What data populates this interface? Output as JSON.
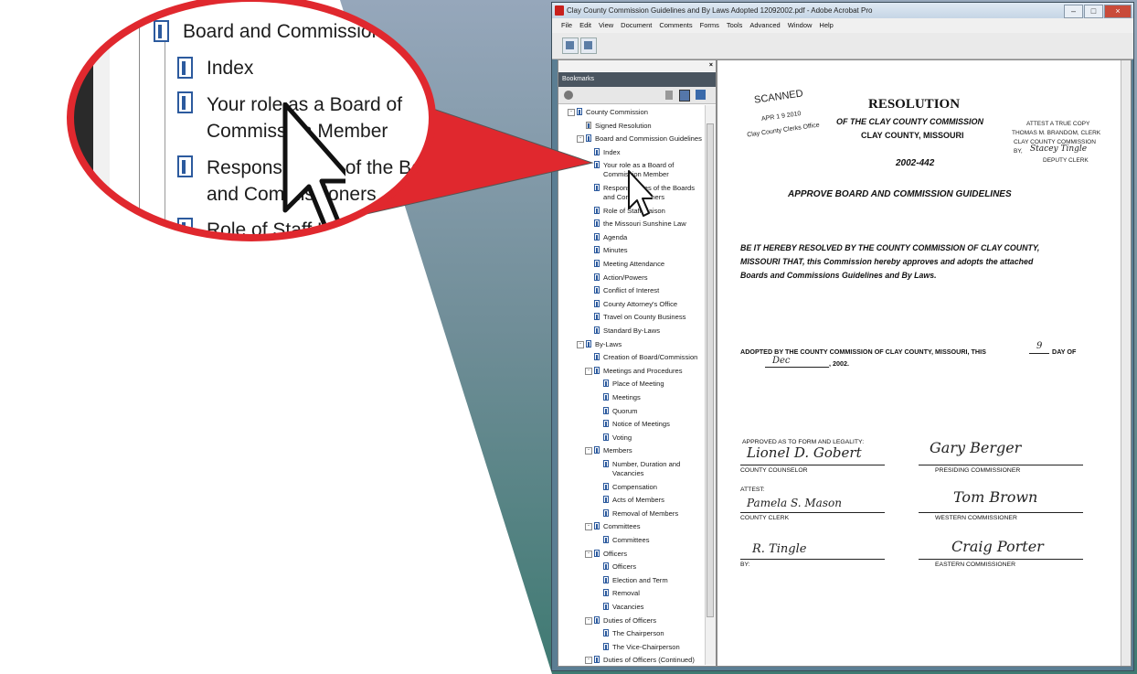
{
  "colors": {
    "accent_red": "#e0282e",
    "wedge_blue": "#8ea3b8",
    "wedge_teal": "#4e7d78"
  },
  "window": {
    "title": "Clay County Commission Guidelines and By Laws Adopted 12092002.pdf - Adobe Acrobat Pro",
    "controls": [
      "–",
      "□",
      "×"
    ]
  },
  "menu": [
    "File",
    "Edit",
    "View",
    "Document",
    "Comments",
    "Forms",
    "Tools",
    "Advanced",
    "Window",
    "Help"
  ],
  "panel": {
    "title": "Bookmarks",
    "close": "×"
  },
  "bookmarks": [
    {
      "label": "County Commission",
      "level": 0,
      "toggle": "-"
    },
    {
      "label": "Signed Resolution",
      "level": 1,
      "gray": true
    },
    {
      "label": "Board and Commission Guidelines",
      "level": 1,
      "toggle": "-"
    },
    {
      "label": "Index",
      "level": 2
    },
    {
      "label": "Your role as a Board of",
      "label2": "Commission Member",
      "level": 2
    },
    {
      "label": "Responsibilities of the Boards",
      "label2": "and Commissioners",
      "level": 2
    },
    {
      "label": "Role of Staff Liaison",
      "level": 2
    },
    {
      "label": "the Missouri Sunshine Law",
      "level": 2
    },
    {
      "label": "Agenda",
      "level": 2
    },
    {
      "label": "Minutes",
      "level": 2
    },
    {
      "label": "Meeting Attendance",
      "level": 2
    },
    {
      "label": "Action/Powers",
      "level": 2
    },
    {
      "label": "Conflict of Interest",
      "level": 2
    },
    {
      "label": "County Attorney's Office",
      "level": 2
    },
    {
      "label": "Travel on County Business",
      "level": 2
    },
    {
      "label": "Standard By-Laws",
      "level": 2
    },
    {
      "label": "By-Laws",
      "level": 1,
      "toggle": "-"
    },
    {
      "label": "Creation of Board/Commission",
      "level": 2
    },
    {
      "label": "Meetings and Procedures",
      "level": 2,
      "toggle": "-"
    },
    {
      "label": "Place of Meeting",
      "level": 3
    },
    {
      "label": "Meetings",
      "level": 3
    },
    {
      "label": "Quorum",
      "level": 3
    },
    {
      "label": "Notice of Meetings",
      "level": 3
    },
    {
      "label": "Voting",
      "level": 3
    },
    {
      "label": "Members",
      "level": 2,
      "toggle": "-"
    },
    {
      "label": "Number, Duration and",
      "label2": "Vacancies",
      "level": 3
    },
    {
      "label": "Compensation",
      "level": 3
    },
    {
      "label": "Acts of Members",
      "level": 3
    },
    {
      "label": "Removal of Members",
      "level": 3
    },
    {
      "label": "Committees",
      "level": 2,
      "toggle": "-"
    },
    {
      "label": "Committees",
      "level": 3
    },
    {
      "label": "Officers",
      "level": 2,
      "toggle": "-"
    },
    {
      "label": "Officers",
      "level": 3
    },
    {
      "label": "Election and Term",
      "level": 3
    },
    {
      "label": "Removal",
      "level": 3
    },
    {
      "label": "Vacancies",
      "level": 3
    },
    {
      "label": "Duties of Officers",
      "level": 2,
      "toggle": "-"
    },
    {
      "label": "The Chairperson",
      "level": 3
    },
    {
      "label": "The Vice-Chairperson",
      "level": 3
    },
    {
      "label": "Duties of Officers (Continued)",
      "level": 2,
      "toggle": "-"
    }
  ],
  "magnifier": {
    "items": [
      {
        "label": "Board and Commission"
      },
      {
        "label": "Index"
      },
      {
        "label": "Your role as a Board of",
        "label2": "Commission Member"
      },
      {
        "label": "Responsibilities of the Bo",
        "label2": "and Commissioners"
      },
      {
        "label": "Role of Staff Liaison"
      }
    ]
  },
  "document": {
    "stamp_scanned": "SCANNED",
    "stamp_date": "APR 1 9 2010",
    "stamp_office": "Clay County Clerks Office",
    "title": "RESOLUTION",
    "subtitle1": "OF THE CLAY COUNTY COMMISSION",
    "subtitle2": "CLAY COUNTY, MISSOURI",
    "attest_lines": [
      "ATTEST A TRUE COPY",
      "THOMAS M. BRANDOM, CLERK",
      "CLAY COUNTY COMMISSION",
      "BY,",
      "DEPUTY CLERK"
    ],
    "attest_signature": "Stacey Tingle",
    "number": "2002-442",
    "heading": "APPROVE BOARD AND COMMISSION GUIDELINES",
    "body": [
      "BE IT HEREBY RESOLVED BY THE COUNTY COMMISSION OF CLAY COUNTY,",
      "MISSOURI THAT, this Commission hereby approves and adopts the attached",
      "Boards and Commissions Guidelines and By Laws."
    ],
    "adopted_line": "ADOPTED BY THE COUNTY COMMISSION OF CLAY COUNTY, MISSOURI, THIS",
    "adopted_day": "9",
    "adopted_day_label": "DAY OF",
    "adopted_month": "Dec",
    "adopted_year": ", 2002.",
    "approved_label": "APPROVED AS TO FORM AND LEGALITY:",
    "sig_counselor_name": "Lionel D. Gobert",
    "sig_counselor_label": "COUNTY COUNSELOR",
    "sig_presiding_label": "PRESIDING COMMISSIONER",
    "sig_presiding_name": "Gary Berger",
    "attest_label": "ATTEST:",
    "sig_clerk_name": "Pamela S. Mason",
    "sig_clerk_label": "COUNTY CLERK",
    "sig_western_name": "Tom Brown",
    "sig_western_label": "WESTERN COMMISSIONER",
    "sig_by_name": "R. Tingle",
    "sig_by_label": "BY:",
    "sig_eastern_name": "Craig Porter",
    "sig_eastern_label": "EASTERN COMMISSIONER"
  }
}
